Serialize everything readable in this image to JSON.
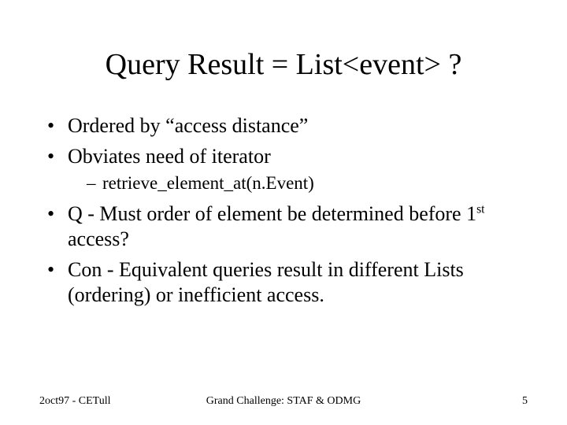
{
  "title": "Query Result = List<event> ?",
  "bullets": {
    "b1": "Ordered by “access distance”",
    "b2": "Obviates need of iterator",
    "b2_sub1": "retrieve_element_at(n.Event)",
    "b3_pre": "Q - Must order of element be determined before 1",
    "b3_sup": "st",
    "b3_post": " access?",
    "b4": "Con - Equivalent queries result in different Lists (ordering) or inefficient access."
  },
  "footer": {
    "left": "2oct97 - CETull",
    "center": "Grand Challenge: STAF & ODMG",
    "right": "5"
  }
}
